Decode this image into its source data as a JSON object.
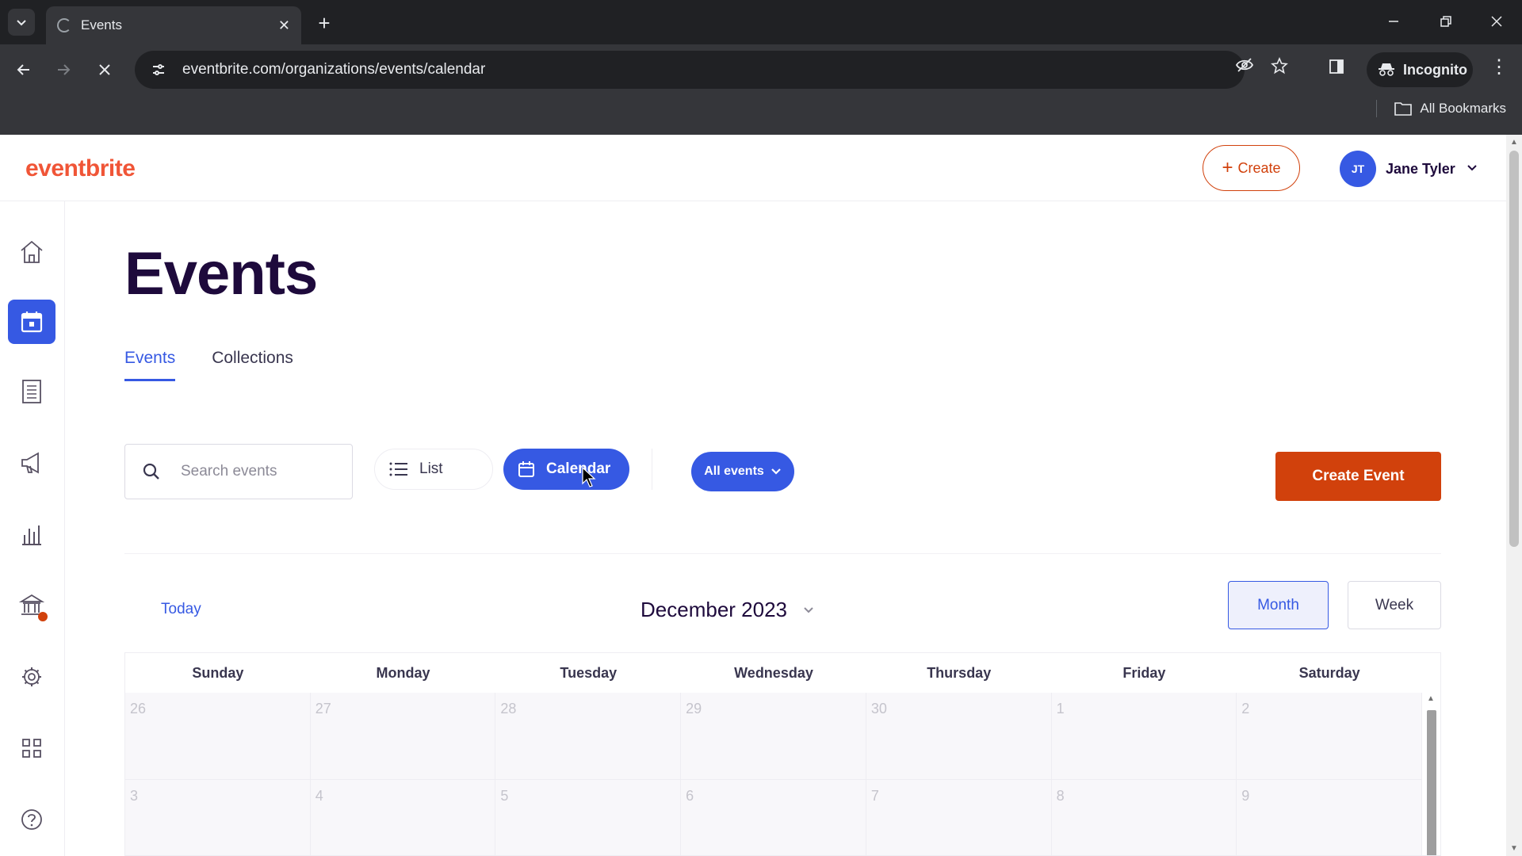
{
  "browser": {
    "tab_title": "Events",
    "url": "eventbrite.com/organizations/events/calendar",
    "incognito_label": "Incognito",
    "bookmarks_label": "All Bookmarks"
  },
  "header": {
    "logo": "eventbrite",
    "create_label": "Create",
    "user_initials": "JT",
    "user_name": "Jane Tyler"
  },
  "sidebar": {
    "items": [
      {
        "icon": "home-icon"
      },
      {
        "icon": "calendar-icon",
        "active": true
      },
      {
        "icon": "orders-icon"
      },
      {
        "icon": "marketing-icon"
      },
      {
        "icon": "reports-icon"
      },
      {
        "icon": "finance-icon",
        "badge": true
      },
      {
        "icon": "settings-icon"
      },
      {
        "icon": "apps-icon"
      },
      {
        "icon": "help-icon"
      }
    ]
  },
  "main": {
    "title": "Events",
    "tabs": [
      {
        "label": "Events",
        "active": true
      },
      {
        "label": "Collections",
        "active": false
      }
    ],
    "search_placeholder": "Search events",
    "view_list_label": "List",
    "view_calendar_label": "Calendar",
    "filter_label": "All events",
    "create_event_label": "Create Event"
  },
  "calendar": {
    "today_label": "Today",
    "month_label": "December 2023",
    "view_month_label": "Month",
    "view_week_label": "Week",
    "weekdays": [
      "Sunday",
      "Monday",
      "Tuesday",
      "Wednesday",
      "Thursday",
      "Friday",
      "Saturday"
    ],
    "weeks": [
      [
        "26",
        "27",
        "28",
        "29",
        "30",
        "1",
        "2"
      ],
      [
        "3",
        "4",
        "5",
        "6",
        "7",
        "8",
        "9"
      ]
    ]
  },
  "colors": {
    "accent": "#3659e3",
    "brand": "#f05537",
    "primary_action": "#d1410c"
  }
}
